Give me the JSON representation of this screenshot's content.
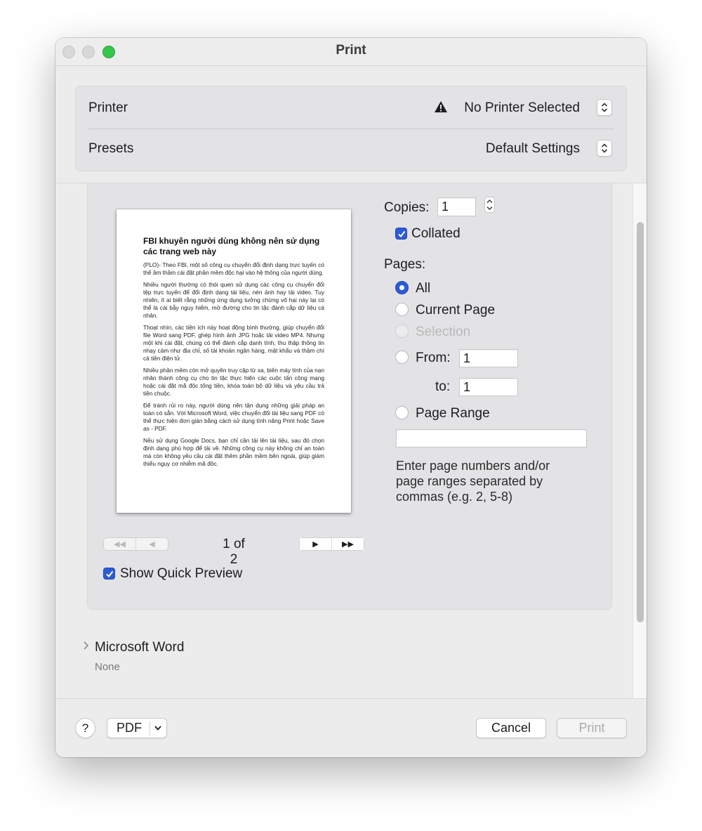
{
  "window": {
    "title": "Print"
  },
  "printer": {
    "label": "Printer",
    "value": "No Printer Selected"
  },
  "presets": {
    "label": "Presets",
    "value": "Default Settings"
  },
  "preview": {
    "heading": "FBI khuyên người dùng không nên sử dụng các trang web này",
    "paragraphs": [
      "(PLO)- Theo FBI, một số công cụ chuyển đổi định dạng trực tuyến có thể âm thầm cài đặt phần mềm độc hại vào hệ thống của người dùng.",
      "Nhiều người thường có thói quen sử dụng các công cụ chuyển đổi tệp trực tuyến để đổi định dạng tài liệu, nén ảnh hay tải video. Tuy nhiên, ít ai biết rằng những ứng dụng tưởng chừng vô hại này lại có thể là cái bẫy nguy hiểm, mở đường cho tin tặc đánh cắp dữ liệu cá nhân.",
      "Thoạt nhìn, các tiện ích này hoạt động bình thường, giúp chuyển đổi file Word sang PDF, ghép hình ảnh JPG hoặc tải video MP4. Nhưng một khi cài đặt, chúng có thể đánh cắp danh tính, thu thập thông tin nhạy cảm như địa chỉ, số tài khoản ngân hàng, mật khẩu và thậm chí cả tiền điện tử.",
      "Nhiều phần mềm còn mở quyền truy cập từ xa, biến máy tính của nạn nhân thành công cụ cho tin tặc thực hiện các cuộc tấn công mạng hoặc cài đặt mã độc tống tiền, khóa toàn bộ dữ liệu và yêu cầu trả tiền chuộc.",
      "Để tránh rủi ro này, người dùng nên tận dụng những giải pháp an toàn có sẵn. Với Microsoft Word, việc chuyển đổi tài liệu sang PDF có thể thực hiện đơn giản bằng cách sử dụng tính năng Print hoặc Save as - PDF.",
      "Nếu sử dụng Google Docs, bạn chỉ cần tải lên tài liệu, sau đó chọn định dạng phù hợp để tải về. Những công cụ này không chỉ an toàn mà còn không yêu cầu cài đặt thêm phần mềm bên ngoài, giúp giảm thiểu nguy cơ nhiễm mã độc."
    ],
    "page_indicator": "1 of 2",
    "nav": {
      "first": "◀◀",
      "prev": "◀",
      "next": "▶",
      "last": "▶▶"
    },
    "show_quick_preview_label": "Show Quick Preview",
    "show_quick_preview_checked": true
  },
  "copies": {
    "label": "Copies:",
    "value": "1"
  },
  "collated": {
    "label": "Collated",
    "checked": true
  },
  "pages": {
    "label": "Pages:",
    "selected": "All",
    "options": {
      "all": "All",
      "current": "Current Page",
      "selection": "Selection",
      "from": "From:",
      "to": "to:",
      "range": "Page Range"
    },
    "from_value": "1",
    "to_value": "1",
    "range_value": "",
    "help": "Enter page numbers and/or page ranges separated by commas (e.g. 2, 5-8)"
  },
  "app_section": {
    "title": "Microsoft Word",
    "subtitle": "None"
  },
  "footer": {
    "help": "?",
    "pdf": "PDF",
    "cancel": "Cancel",
    "print": "Print"
  },
  "colors": {
    "accent": "#2c5bd9",
    "window_bg": "#ececec",
    "panel_bg": "#e3e3e6",
    "zoom_green": "#37c64a"
  },
  "icons": {
    "printer_warning": "warning-icon",
    "popup": "up-down-chevron-icon",
    "disclosure": "chevron-right-icon"
  }
}
